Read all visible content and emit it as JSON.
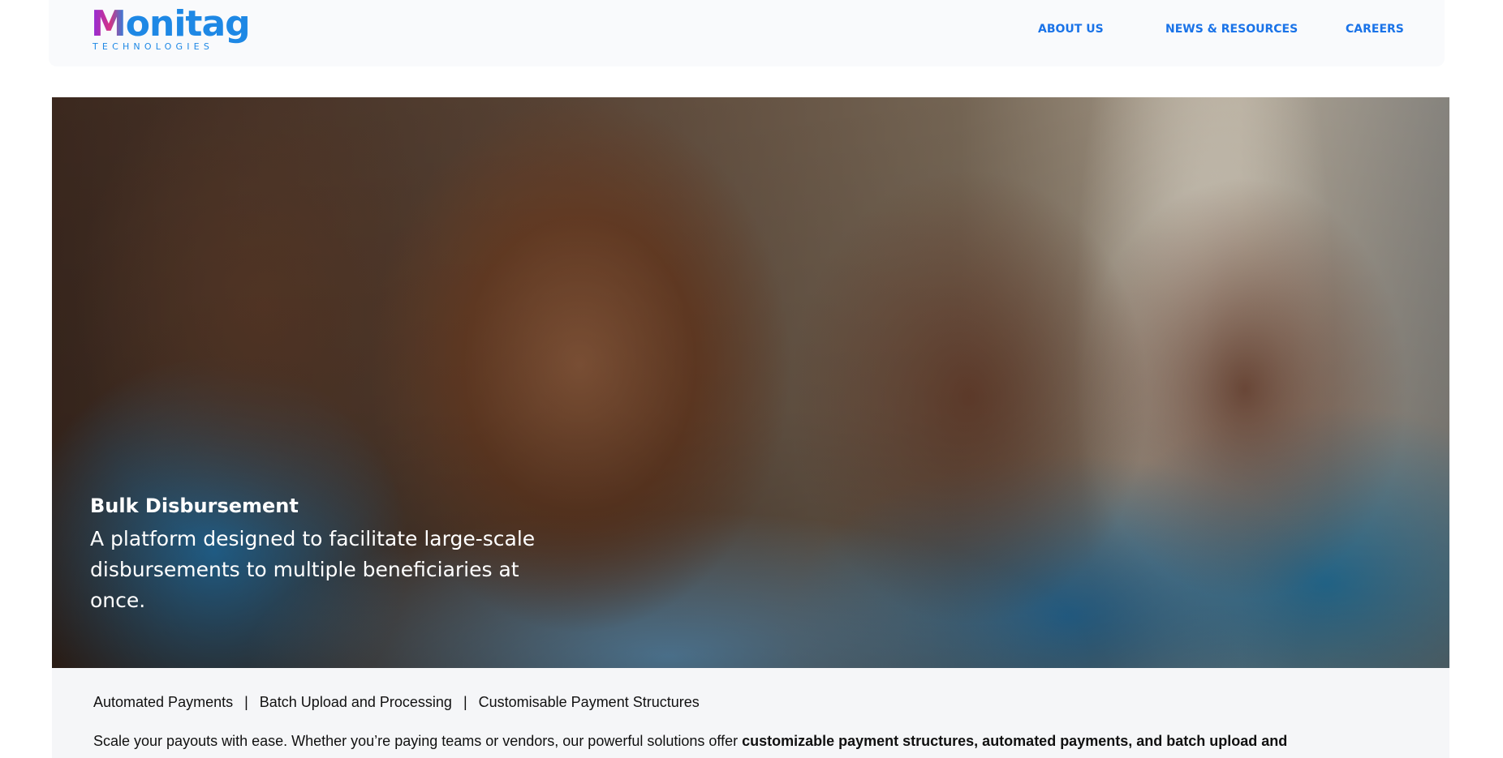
{
  "header": {
    "logo": {
      "wordmark_first": "M",
      "wordmark_rest": "onitag",
      "subtitle": "TECHNOLOGIES"
    },
    "nav": [
      {
        "label": "ABOUT US"
      },
      {
        "label": "NEWS & RESOURCES"
      },
      {
        "label": "CAREERS"
      }
    ]
  },
  "hero": {
    "title": "Bulk Disbursement",
    "text": "A platform designed to facilitate large-scale disbursements to multiple beneficiaries at once."
  },
  "content": {
    "features": [
      {
        "label": "Automated Payments"
      },
      {
        "label": "Batch Upload and Processing"
      },
      {
        "label": "Customisable Payment Structures"
      }
    ],
    "separator": "|",
    "desc_intro": "Scale your payouts with ease. Whether you’re paying teams or vendors, our powerful solutions offer ",
    "desc_bold": "customizable payment structures, automated payments, and batch upload and"
  },
  "colors": {
    "nav": "#1a73e8",
    "brand_blue": "#1e88e5",
    "logo_gradient_start": "#8a2be2",
    "logo_gradient_mid": "#d63384",
    "hero_text": "#ffffff",
    "content_bg": "#f5f6f8"
  }
}
